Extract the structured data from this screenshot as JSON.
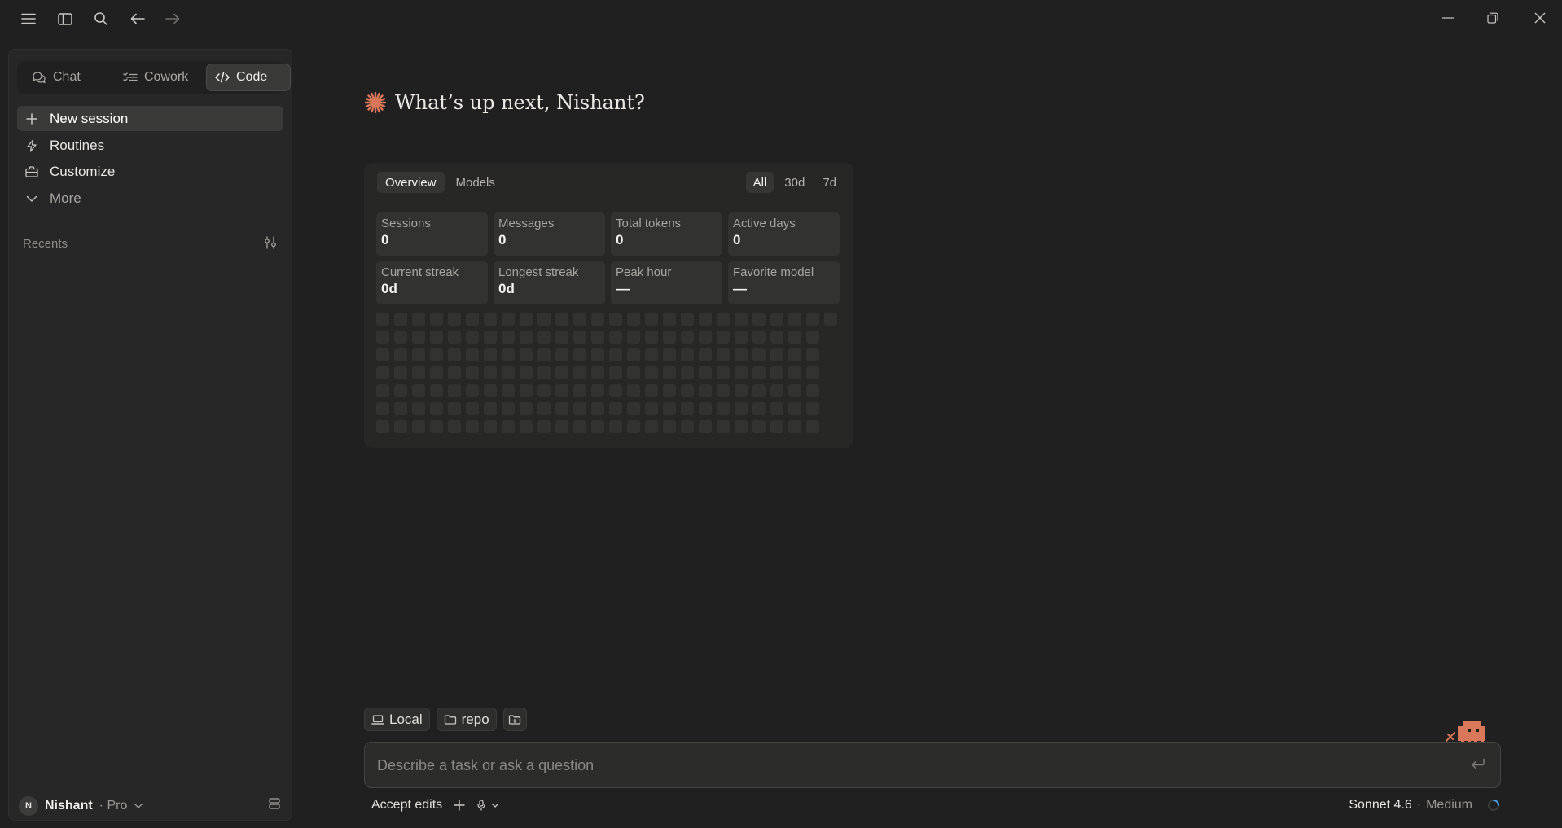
{
  "titlebar": {
    "icons": [
      "menu-icon",
      "sidebar-icon",
      "search-icon",
      "back-arrow-icon",
      "forward-arrow-icon"
    ],
    "window_controls": [
      "minimize-icon",
      "restore-icon",
      "close-icon"
    ]
  },
  "sidebar": {
    "modes": [
      {
        "label": "Chat",
        "icon": "chat-bubbles-icon"
      },
      {
        "label": "Cowork",
        "icon": "checklist-icon"
      },
      {
        "label": "Code",
        "icon": "code-brackets-icon",
        "active": true
      }
    ],
    "nav": [
      {
        "label": "New session",
        "icon": "plus-icon",
        "active": true
      },
      {
        "label": "Routines",
        "icon": "lightning-icon"
      },
      {
        "label": "Customize",
        "icon": "briefcase-icon"
      },
      {
        "label": "More",
        "icon": "chevron-down-icon"
      }
    ],
    "recents_label": "Recents",
    "user": {
      "initial": "N",
      "name": "Nishant",
      "plan": "· Pro"
    }
  },
  "main": {
    "greeting": "What’s up next, Nishant?",
    "stats": {
      "tabs": [
        "Overview",
        "Models"
      ],
      "ranges": [
        "All",
        "30d",
        "7d"
      ],
      "cells": [
        {
          "label": "Sessions",
          "value": "0"
        },
        {
          "label": "Messages",
          "value": "0"
        },
        {
          "label": "Total tokens",
          "value": "0"
        },
        {
          "label": "Active days",
          "value": "0"
        },
        {
          "label": "Current streak",
          "value": "0d"
        },
        {
          "label": "Longest streak",
          "value": "0d"
        },
        {
          "label": "Peak hour",
          "value": "—"
        },
        {
          "label": "Favorite model",
          "value": "—"
        }
      ],
      "heatmap_weeks": 25,
      "heatmap_days": 7
    },
    "chips": [
      {
        "label": "Local",
        "icon": "laptop-icon"
      },
      {
        "label": "repo",
        "icon": "folder-icon"
      }
    ],
    "prompt_placeholder": "Describe a task or ask a question",
    "accept_label": "Accept edits",
    "model": {
      "name": "Sonnet 4.6",
      "sep": "·",
      "effort": "Medium"
    }
  },
  "colors": {
    "accent": "#d9775a",
    "background": "#202020",
    "sidebar": "#272727"
  }
}
